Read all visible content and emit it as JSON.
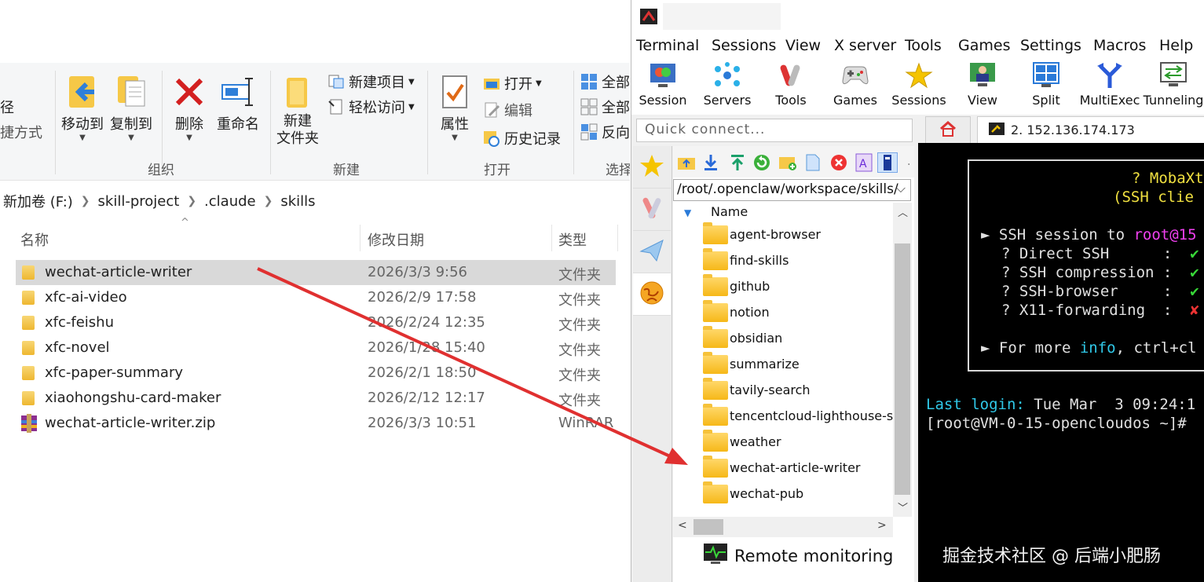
{
  "explorer": {
    "ribbon": {
      "path_label": "径",
      "shortcut_label": "捷方式",
      "move_to": "移动到",
      "copy_to": "复制到",
      "delete": "删除",
      "rename": "重命名",
      "new_folder": "新建\n文件夹",
      "new_item": "新建项目",
      "easy_access": "轻松访问",
      "properties": "属性",
      "open": "打开",
      "edit": "编辑",
      "history": "历史记录",
      "select_all": "全部",
      "select_none": "全部",
      "invert": "反向",
      "groups": {
        "organize": "组织",
        "new": "新建",
        "open": "打开",
        "select": "选择"
      }
    },
    "breadcrumb": [
      "新加卷 (F:)",
      "skill-project",
      ".claude",
      "skills"
    ],
    "columns": {
      "name": "名称",
      "date": "修改日期",
      "type": "类型"
    },
    "files": [
      {
        "name": "wechat-article-writer",
        "date": "2026/3/3 9:56",
        "type": "文件夹",
        "kind": "folder"
      },
      {
        "name": "xfc-ai-video",
        "date": "2026/2/9 17:58",
        "type": "文件夹",
        "kind": "folder"
      },
      {
        "name": "xfc-feishu",
        "date": "2026/2/24 12:35",
        "type": "文件夹",
        "kind": "folder"
      },
      {
        "name": "xfc-novel",
        "date": "2026/1/28 15:40",
        "type": "文件夹",
        "kind": "folder"
      },
      {
        "name": "xfc-paper-summary",
        "date": "2026/2/1 18:50",
        "type": "文件夹",
        "kind": "folder"
      },
      {
        "name": "xiaohongshu-card-maker",
        "date": "2026/2/12 12:17",
        "type": "文件夹",
        "kind": "folder"
      },
      {
        "name": "wechat-article-writer.zip",
        "date": "2026/3/3 10:51",
        "type": "WinRAR",
        "kind": "archive"
      }
    ]
  },
  "moba": {
    "menu": [
      "Terminal",
      "Sessions",
      "View",
      "X server",
      "Tools",
      "Games",
      "Settings",
      "Macros",
      "Help"
    ],
    "toolbar": [
      "Session",
      "Servers",
      "Tools",
      "Games",
      "Sessions",
      "View",
      "Split",
      "MultiExec",
      "Tunneling"
    ],
    "quick_connect_placeholder": "Quick connect...",
    "ssh_tab": "2. 152.136.174.173",
    "sftp_path": "/root/.openclaw/workspace/skills/",
    "list_header": "Name",
    "remote_folders": [
      "agent-browser",
      "find-skills",
      "github",
      "notion",
      "obsidian",
      "summarize",
      "tavily-search",
      "tencentcloud-lighthouse-skill",
      "weather",
      "wechat-article-writer",
      "wechat-pub"
    ],
    "remote_monitoring": "Remote monitoring",
    "terminal": {
      "banner_title": "? MobaXt",
      "banner_sub": "(SSH clie",
      "session_line_prefix": "► SSH session to ",
      "session_host": "root@15",
      "rows": [
        {
          "label": "? Direct SSH      :",
          "mark": "✔"
        },
        {
          "label": "? SSH compression :",
          "mark": "✔"
        },
        {
          "label": "? SSH-browser     :",
          "mark": "✔"
        },
        {
          "label": "? X11-forwarding  :",
          "mark": "✘"
        }
      ],
      "more_prefix": "► For more ",
      "more_info": "info",
      "more_suffix": ", ctrl+cl",
      "last_login_label": "Last login:",
      "last_login_value": " Tue Mar  3 09:24:1",
      "prompt": "[root@VM-0-15-opencloudos ~]#"
    }
  },
  "watermark": "掘金技术社区 @ 后端小肥肠",
  "colors": {
    "arrow": "#e03030",
    "terminal_green": "#38d838",
    "terminal_cyan": "#30c8e8",
    "terminal_magenta": "#f040f0",
    "terminal_yellow": "#f0e040"
  }
}
